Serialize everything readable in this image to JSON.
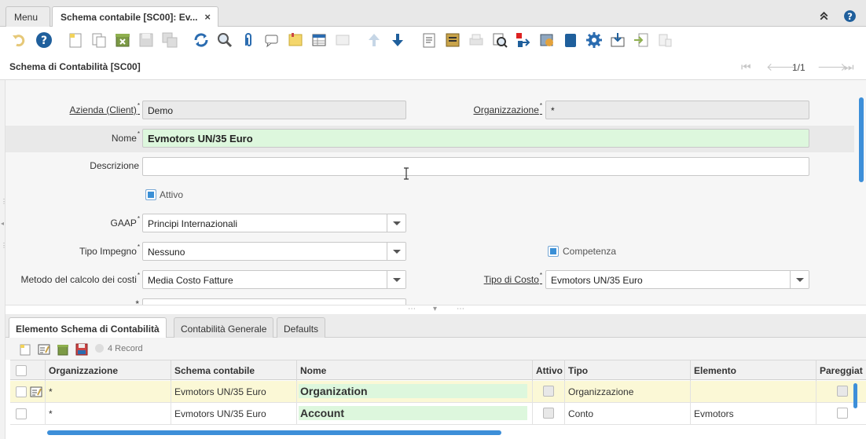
{
  "tabs": [
    {
      "label": "Menu"
    },
    {
      "label": "Schema contabile [SC00]: Ev...",
      "close": "×"
    }
  ],
  "window": {
    "title": "Schema di Contabilità [SC00]",
    "record_nav": "1/1"
  },
  "form": {
    "client_label": "Azienda (Client)",
    "client_value": "Demo",
    "org_label": "Organizzazione",
    "org_value": "*",
    "name_label": "Nome",
    "name_value": "Evmotors UN/35 Euro",
    "desc_label": "Descrizione",
    "desc_value": "",
    "active_label": "Attivo",
    "gaap_label": "GAAP",
    "gaap_value": "Principi Internazionali",
    "commitment_label": "Tipo Impegno",
    "commitment_value": "Nessuno",
    "accrual_label": "Competenza",
    "costing_label": "Metodo del calcolo dei costi",
    "costing_value": "Media Costo Fatture",
    "costtype_label": "Tipo di Costo",
    "costtype_value": "Evmotors UN/35 Euro",
    "required_mark": "*"
  },
  "detail_tabs": [
    {
      "label": "Elemento Schema di Contabilità"
    },
    {
      "label": "Contabilità Generale"
    },
    {
      "label": "Defaults"
    }
  ],
  "detail_toolbar": {
    "record_count": "4 Record"
  },
  "grid": {
    "columns": [
      "Organizzazione",
      "Schema contabile",
      "Nome",
      "Attivo",
      "Tipo",
      "Elemento",
      "Pareggiat"
    ],
    "rows": [
      {
        "org": "*",
        "schema": "Evmotors UN/35 Euro",
        "name": "Organization",
        "type": "Organizzazione",
        "element": ""
      },
      {
        "org": "*",
        "schema": "Evmotors UN/35 Euro",
        "name": "Account",
        "type": "Conto",
        "element": "Evmotors"
      }
    ]
  },
  "colors": {
    "accent": "#3d8fd9",
    "mandatory_bg": "#ddf7dd",
    "selected_row": "#fbf8d6"
  },
  "icons": [
    "undo-icon",
    "help-icon",
    "new-record-icon",
    "copy-record-icon",
    "delete-icon",
    "save-icon",
    "save-new-icon",
    "refresh-icon",
    "find-icon",
    "attachment-icon",
    "chat-icon",
    "postit-icon",
    "grid-toggle-icon",
    "parent-icon",
    "previous-icon",
    "next-icon",
    "report-icon",
    "archive-icon",
    "print-icon",
    "zoom-across-icon",
    "requests-icon",
    "workflow-icon",
    "product-info-icon",
    "process-icon",
    "export-icon",
    "import-icon",
    "quick-entry-icon"
  ]
}
